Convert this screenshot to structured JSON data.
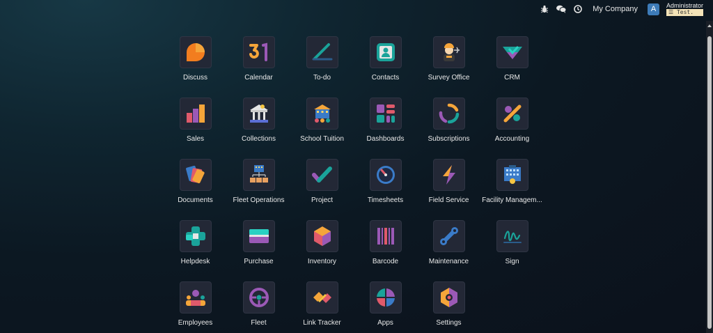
{
  "topbar": {
    "company": "My Company",
    "avatar_letter": "A",
    "user_name": "Administrator",
    "db_name": "Test."
  },
  "apps": [
    {
      "label": "Discuss",
      "icon": "discuss-icon"
    },
    {
      "label": "Calendar",
      "icon": "calendar-icon"
    },
    {
      "label": "To-do",
      "icon": "todo-icon"
    },
    {
      "label": "Contacts",
      "icon": "contacts-icon"
    },
    {
      "label": "Survey Office",
      "icon": "survey-office-icon"
    },
    {
      "label": "CRM",
      "icon": "crm-icon"
    },
    {
      "label": "Sales",
      "icon": "sales-icon"
    },
    {
      "label": "Collections",
      "icon": "collections-icon"
    },
    {
      "label": "School Tuition",
      "icon": "school-tuition-icon"
    },
    {
      "label": "Dashboards",
      "icon": "dashboards-icon"
    },
    {
      "label": "Subscriptions",
      "icon": "subscriptions-icon"
    },
    {
      "label": "Accounting",
      "icon": "accounting-icon"
    },
    {
      "label": "Documents",
      "icon": "documents-icon"
    },
    {
      "label": "Fleet Operations",
      "icon": "fleet-operations-icon"
    },
    {
      "label": "Project",
      "icon": "project-icon"
    },
    {
      "label": "Timesheets",
      "icon": "timesheets-icon"
    },
    {
      "label": "Field Service",
      "icon": "field-service-icon"
    },
    {
      "label": "Facility Managem...",
      "icon": "facility-management-icon"
    },
    {
      "label": "Helpdesk",
      "icon": "helpdesk-icon"
    },
    {
      "label": "Purchase",
      "icon": "purchase-icon"
    },
    {
      "label": "Inventory",
      "icon": "inventory-icon"
    },
    {
      "label": "Barcode",
      "icon": "barcode-icon"
    },
    {
      "label": "Maintenance",
      "icon": "maintenance-icon"
    },
    {
      "label": "Sign",
      "icon": "sign-icon"
    },
    {
      "label": "Employees",
      "icon": "employees-icon"
    },
    {
      "label": "Fleet",
      "icon": "fleet-icon"
    },
    {
      "label": "Link Tracker",
      "icon": "link-tracker-icon"
    },
    {
      "label": "Apps",
      "icon": "apps-icon"
    },
    {
      "label": "Settings",
      "icon": "settings-icon"
    }
  ]
}
